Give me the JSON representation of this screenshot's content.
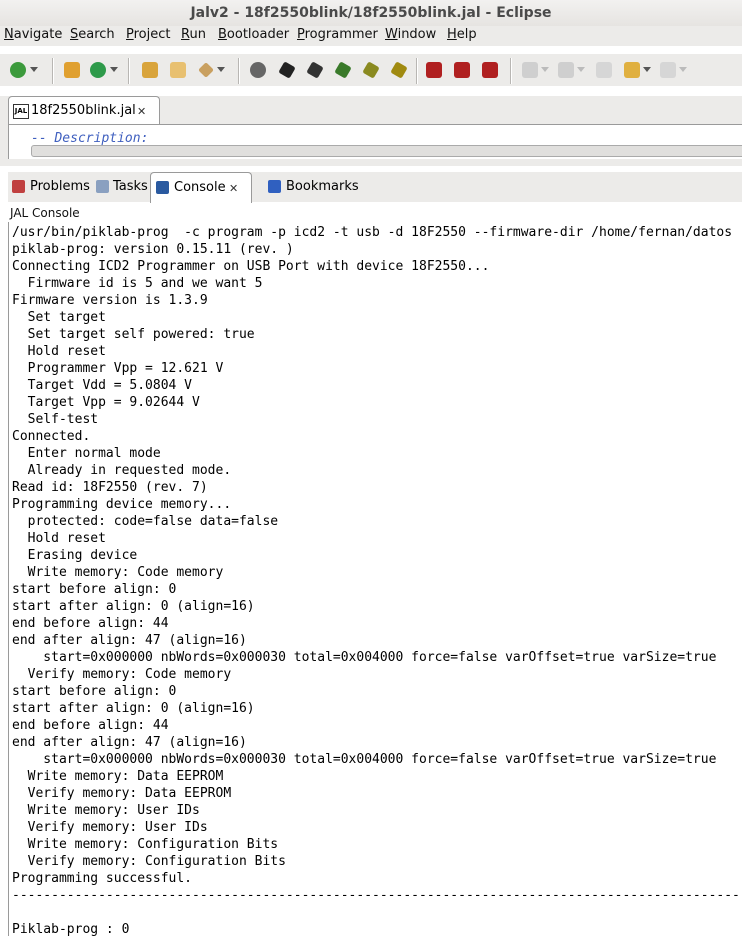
{
  "window": {
    "title": "Jalv2 - 18f2550blink/18f2550blink.jal - Eclipse"
  },
  "menu": [
    "Navigate",
    "Search",
    "Project",
    "Run",
    "Bootloader",
    "Programmer",
    "Window",
    "Help"
  ],
  "editor": {
    "tab_label": "18f2550blink.jal",
    "tab_icon_text": "JAL",
    "visible_line": "-- Description:"
  },
  "views": {
    "tabs": [
      "Problems",
      "Tasks",
      "Console",
      "Bookmarks"
    ],
    "active_tab": "Console"
  },
  "console": {
    "title": "JAL Console",
    "lines": [
      "/usr/bin/piklab-prog  -c program -p icd2 -t usb -d 18F2550 --firmware-dir /home/fernan/datos",
      "piklab-prog: version 0.15.11 (rev. )",
      "Connecting ICD2 Programmer on USB Port with device 18F2550...",
      "  Firmware id is 5 and we want 5",
      "Firmware version is 1.3.9",
      "  Set target",
      "  Set target self powered: true",
      "  Hold reset",
      "  Programmer Vpp = 12.621 V",
      "  Target Vdd = 5.0804 V",
      "  Target Vpp = 9.02644 V",
      "  Self-test",
      "Connected.",
      "  Enter normal mode",
      "  Already in requested mode.",
      "Read id: 18F2550 (rev. 7)",
      "Programming device memory...",
      "  protected: code=false data=false",
      "  Hold reset",
      "  Erasing device",
      "  Write memory: Code memory",
      "start before align: 0",
      "start after align: 0 (align=16)",
      "end before align: 44",
      "end after align: 47 (align=16)",
      "    start=0x000000 nbWords=0x000030 total=0x004000 force=false varOffset=true varSize=true",
      "  Verify memory: Code memory",
      "start before align: 0",
      "start after align: 0 (align=16)",
      "end before align: 44",
      "end after align: 47 (align=16)",
      "    start=0x000000 nbWords=0x000030 total=0x004000 force=false varOffset=true varSize=true",
      "  Write memory: Data EEPROM",
      "  Verify memory: Data EEPROM",
      "  Write memory: User IDs",
      "  Verify memory: User IDs",
      "  Write memory: Configuration Bits",
      "  Verify memory: Configuration Bits",
      "Programming successful.",
      "------------------------------------------------------------------------------------------------",
      "",
      "Piklab-prog : 0"
    ]
  },
  "colors": {
    "chrome": "#ecebe9",
    "comment": "#3f5fbf"
  }
}
